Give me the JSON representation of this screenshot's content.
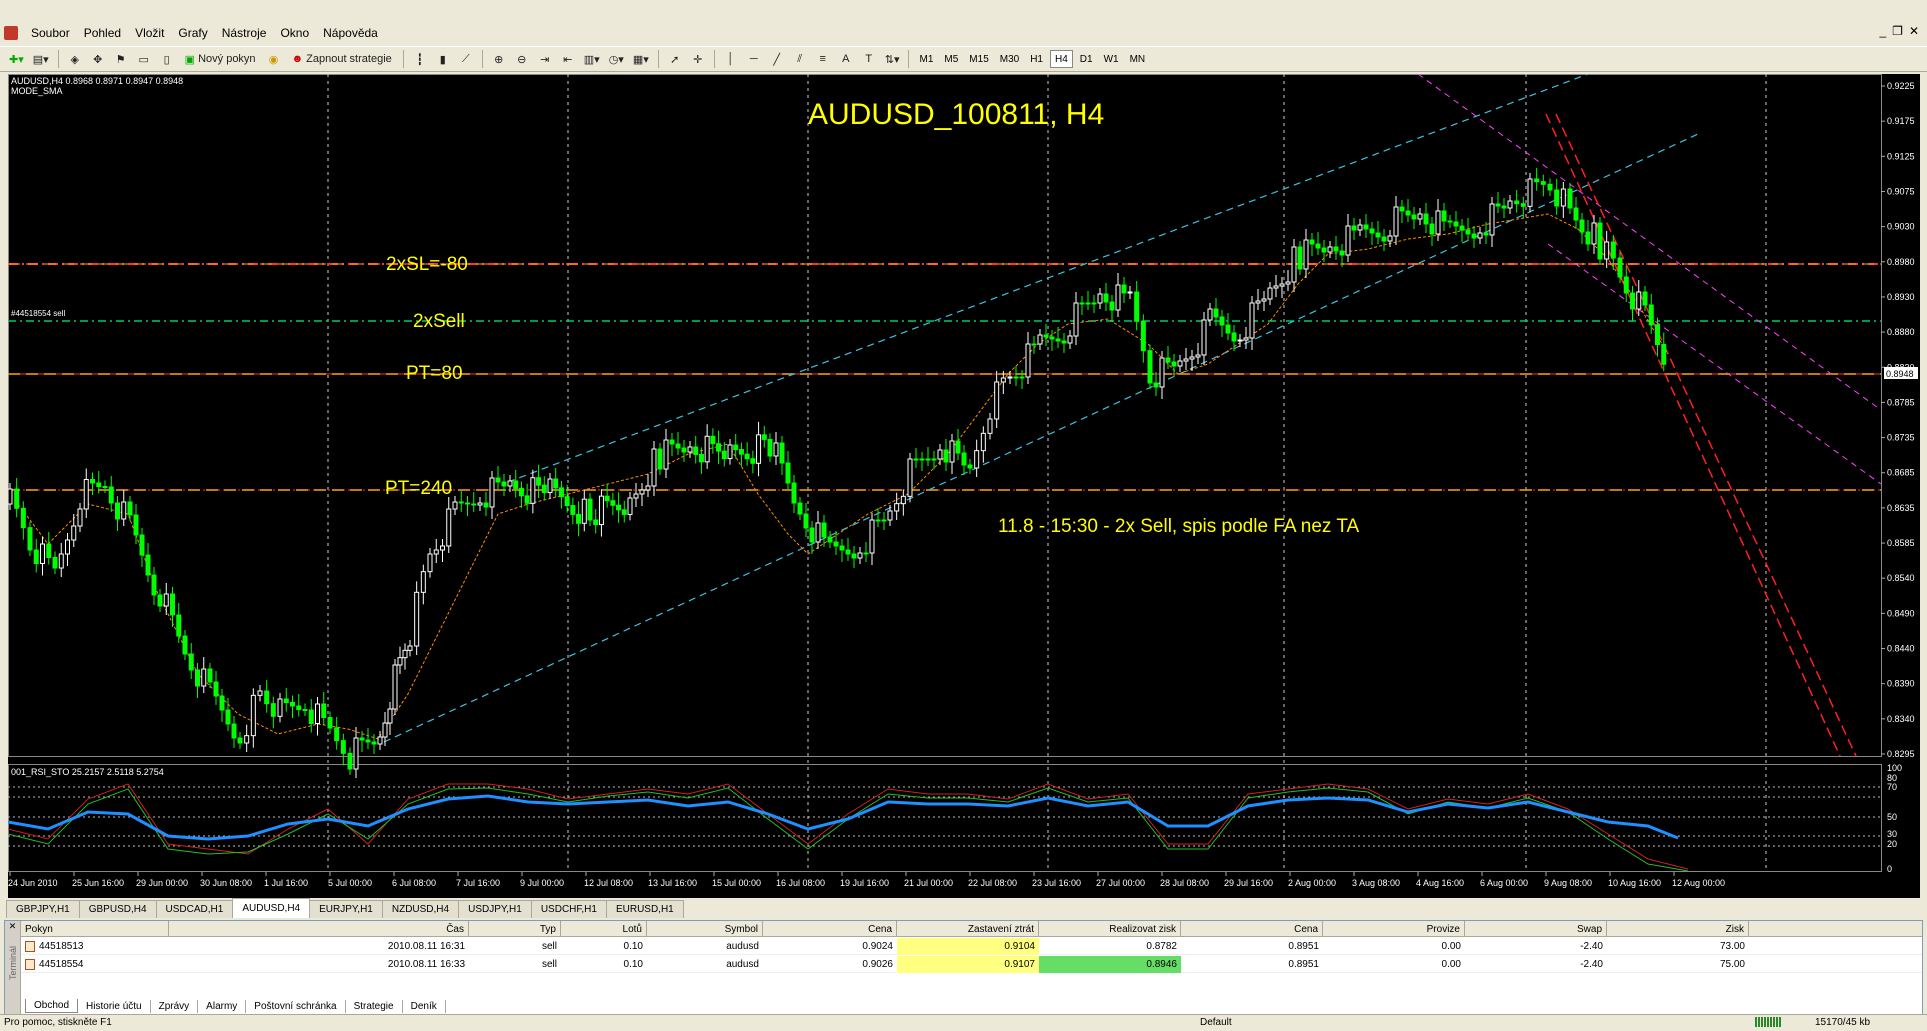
{
  "menu": {
    "items": [
      "Soubor",
      "Pohled",
      "Vložit",
      "Grafy",
      "Nástroje",
      "Okno",
      "Nápověda"
    ]
  },
  "toolbar": {
    "new_order": "Nový pokyn",
    "expert": "Zapnout strategie",
    "timeframes": [
      "M1",
      "M5",
      "M15",
      "M30",
      "H1",
      "H4",
      "D1",
      "W1",
      "MN"
    ],
    "active_tf": "H4"
  },
  "chart": {
    "info_line": "AUDUSD,H4  0.8968 0.8971 0.8947 0.8948",
    "indicator_name": "MODE_SMA",
    "title": "AUDUSD_100811,  H4",
    "order_label": "#44518554 sell",
    "annotations": {
      "sl": "2xSL=-80",
      "sell": "2xSell",
      "pt80": "PT=80",
      "pt240": "PT=240",
      "note": "11.8 - 15:30 - 2x Sell, spis podle FA nez TA"
    },
    "price_ticks": [
      "0.9225",
      "0.9175",
      "0.9125",
      "0.9075",
      "0.9030",
      "0.8980",
      "0.8948",
      "0.8930",
      "0.8880",
      "0.8830",
      "0.8785",
      "0.8735",
      "0.8685",
      "0.8635",
      "0.8585",
      "0.8540",
      "0.8490",
      "0.8440",
      "0.8390",
      "0.8340",
      "0.8295"
    ],
    "current_price": "0.8948",
    "osc_label": "001_RSI_STO 25.2157 2.5118 5.2754",
    "osc_ticks": [
      "100",
      "80",
      "70",
      "50",
      "30",
      "20",
      "0"
    ],
    "time_labels": [
      "24 Jun 2010",
      "25 Jun 16:00",
      "29 Jun 00:00",
      "30 Jun 08:00",
      "1 Jul 16:00",
      "5 Jul 00:00",
      "6 Jul 08:00",
      "7 Jul 16:00",
      "9 Jul 00:00",
      "12 Jul 08:00",
      "13 Jul 16:00",
      "15 Jul 00:00",
      "16 Jul 08:00",
      "19 Jul 16:00",
      "21 Jul 00:00",
      "22 Jul 08:00",
      "23 Jul 16:00",
      "27 Jul 00:00",
      "28 Jul 08:00",
      "29 Jul 16:00",
      "2 Aug 00:00",
      "3 Aug 08:00",
      "4 Aug 16:00",
      "6 Aug 00:00",
      "9 Aug 08:00",
      "10 Aug 16:00",
      "12 Aug 00:00"
    ]
  },
  "chart_tabs": [
    "GBPJPY,H1",
    "GBPUSD,H4",
    "USDCAD,H1",
    "AUDUSD,H4",
    "EURJPY,H1",
    "NZDUSD,H4",
    "USDJPY,H1",
    "USDCHF,H1",
    "EURUSD,H1"
  ],
  "active_chart_tab": "AUDUSD,H4",
  "terminal": {
    "columns": [
      "Pokyn",
      "Čas",
      "Typ",
      "Lotů",
      "Symbol",
      "Cena",
      "Zastavení ztrát",
      "Realizovat zisk",
      "Cena",
      "Provize",
      "Swap",
      "Zisk"
    ],
    "rows": [
      [
        "44518513",
        "2010.08.11 16:31",
        "sell",
        "0.10",
        "audusd",
        "0.9024",
        "0.9104",
        "0.8782",
        "0.8951",
        "0.00",
        "-2.40",
        "73.00"
      ],
      [
        "44518554",
        "2010.08.11 16:33",
        "sell",
        "0.10",
        "audusd",
        "0.9026",
        "0.9107",
        "0.8946",
        "0.8951",
        "0.00",
        "-2.40",
        "75.00"
      ]
    ],
    "tabs": [
      "Obchod",
      "Historie účtu",
      "Zprávy",
      "Alarmy",
      "Poštovní schránka",
      "Strategie",
      "Deník"
    ],
    "active_tab": "Obchod",
    "side_label": "Terminál"
  },
  "status": {
    "help": "Pro pomoc, stiskněte F1",
    "profile": "Default",
    "traffic": "15170/45 kb"
  },
  "colors": {
    "bull": "#ffffff",
    "bear": "#00ff00",
    "sl": "#ff3030",
    "sell": "#00cc66",
    "pt": "#ff8c00",
    "annotation": "#ffff00",
    "channel": "#40c0e0",
    "magenta": "#ff40ff",
    "downtrend": "#ff2020",
    "osc_main": "#1e90ff"
  }
}
